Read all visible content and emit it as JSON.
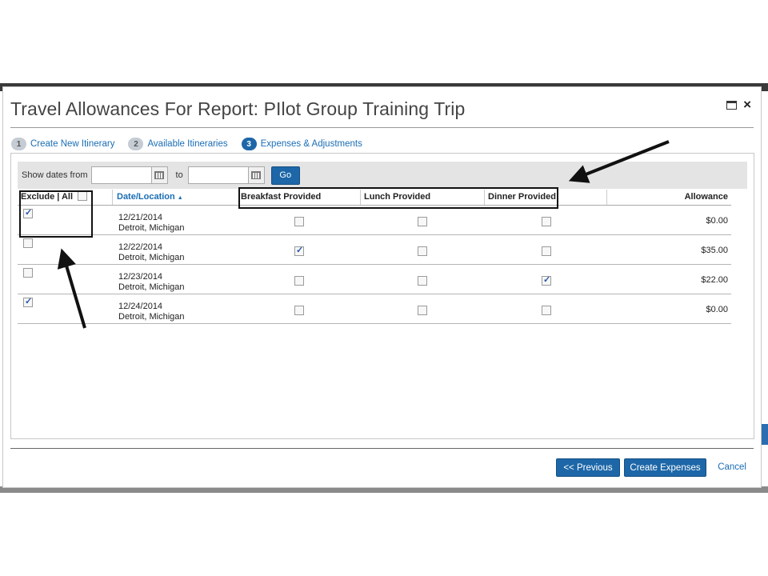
{
  "dialog": {
    "title": "Travel Allowances For Report: PIlot Group Training Trip"
  },
  "steps": [
    {
      "num": "1",
      "label": "Create New Itinerary",
      "active": false
    },
    {
      "num": "2",
      "label": "Available Itineraries",
      "active": false
    },
    {
      "num": "3",
      "label": "Expenses & Adjustments",
      "active": true
    }
  ],
  "filter": {
    "show_from_label": "Show dates from",
    "to_label": "to",
    "from_value": "",
    "to_value": "",
    "go_label": "Go"
  },
  "table": {
    "headers": {
      "exclude": "Exclude | All",
      "date_location": "Date/Location",
      "sort_indicator": "▲",
      "breakfast": "Breakfast Provided",
      "lunch": "Lunch Provided",
      "dinner": "Dinner Provided",
      "allowance": "Allowance"
    },
    "rows": [
      {
        "date": "12/21/2014",
        "location": "Detroit, Michigan",
        "exclude": true,
        "breakfast": false,
        "lunch": false,
        "dinner": false,
        "allowance": "$0.00"
      },
      {
        "date": "12/22/2014",
        "location": "Detroit, Michigan",
        "exclude": false,
        "breakfast": true,
        "lunch": false,
        "dinner": false,
        "allowance": "$35.00"
      },
      {
        "date": "12/23/2014",
        "location": "Detroit, Michigan",
        "exclude": false,
        "breakfast": false,
        "lunch": false,
        "dinner": true,
        "allowance": "$22.00"
      },
      {
        "date": "12/24/2014",
        "location": "Detroit, Michigan",
        "exclude": true,
        "breakfast": false,
        "lunch": false,
        "dinner": false,
        "allowance": "$0.00"
      }
    ]
  },
  "footer": {
    "previous_label": "<< Previous",
    "create_label": "Create Expenses",
    "cancel_label": "Cancel"
  },
  "colors": {
    "primary_button": "#1d67a8",
    "link": "#1a6db5"
  }
}
